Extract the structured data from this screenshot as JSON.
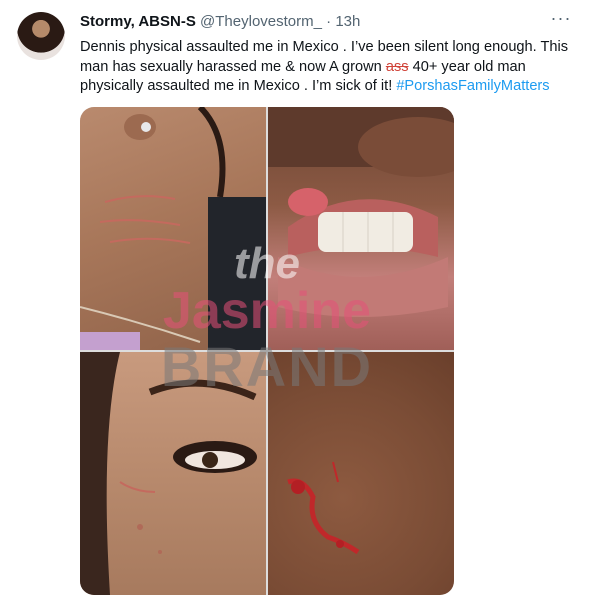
{
  "tweet": {
    "display_name": "Stormy, ABSN-S",
    "handle": "@Theylovestorm_",
    "separator": "·",
    "time": "13h",
    "more": "···",
    "text_before": "Dennis physical assaulted me in Mexico . I’ve been silent long enough. This man has sexually harassed me & now A grown ",
    "text_struck": "ass",
    "text_after": " 40+ year old man physically assaulted me in Mexico . I’m sick of it! ",
    "hashtag": "#PorshasFamilyMatters"
  },
  "watermark": {
    "line1": "the",
    "line2": "Jasmine",
    "line3": "BRAND"
  },
  "colors": {
    "link": "#1d9bf0",
    "secondary_text": "#536471",
    "strike": "#d0443a"
  }
}
